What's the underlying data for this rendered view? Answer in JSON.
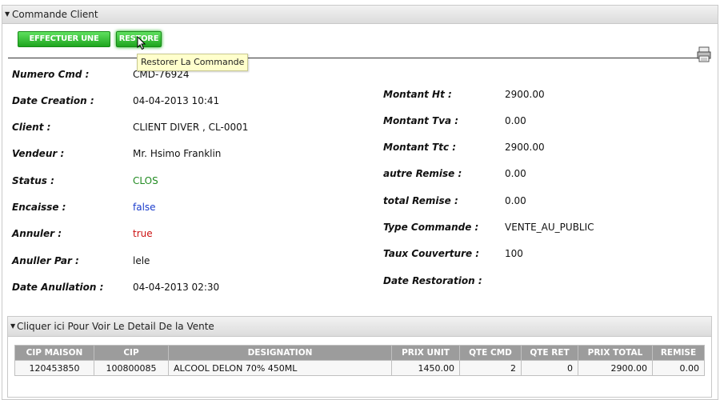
{
  "panel": {
    "title": "Commande Client"
  },
  "toolbar": {
    "effectuer_label": "EFFECTUER UNE VENTE",
    "restore_label": "RESTORE",
    "tooltip": "Restorer La Commande"
  },
  "left_fields": [
    {
      "label": "Numero Cmd :",
      "value": "CMD-76924"
    },
    {
      "label": "Date Creation :",
      "value": "04-04-2013 10:41"
    },
    {
      "label": "Client :",
      "value": "CLIENT DIVER , CL-0001"
    },
    {
      "label": "Vendeur :",
      "value": "Mr. Hsimo Franklin"
    },
    {
      "label": "Status :",
      "value": "CLOS"
    },
    {
      "label": "Encaisse :",
      "value": "false"
    },
    {
      "label": "Annuler :",
      "value": "true"
    },
    {
      "label": "Anuller Par :",
      "value": "lele"
    },
    {
      "label": "Date Anullation :",
      "value": "04-04-2013 02:30"
    }
  ],
  "right_fields": [
    {
      "label": "Montant Ht :",
      "value": "2900.00"
    },
    {
      "label": "Montant Tva :",
      "value": "0.00"
    },
    {
      "label": "Montant Ttc :",
      "value": "2900.00"
    },
    {
      "label": "autre Remise :",
      "value": "0.00"
    },
    {
      "label": "total Remise :",
      "value": "0.00"
    },
    {
      "label": "Type Commande :",
      "value": "VENTE_AU_PUBLIC"
    },
    {
      "label": "Taux Couverture :",
      "value": "100"
    },
    {
      "label": "Date Restoration :",
      "value": ""
    }
  ],
  "status_colors": {
    "clos": "#228b22",
    "false": "#1a3ccc",
    "true": "#cc1111"
  },
  "detail": {
    "title": "Cliquer ici Pour Voir Le Detail De la Vente",
    "columns": [
      "CIP MAISON",
      "CIP",
      "DESIGNATION",
      "PRIX UNIT",
      "QTE CMD",
      "QTE RET",
      "PRIX TOTAL",
      "REMISE"
    ],
    "rows": [
      [
        "120453850",
        "100800085",
        "ALCOOL DELON 70% 450ML",
        "1450.00",
        "2",
        "0",
        "2900.00",
        "0.00"
      ]
    ]
  },
  "icons": {
    "print": "print-icon",
    "collapse": "triangle-down-icon",
    "cursor": "mouse-cursor-icon"
  }
}
